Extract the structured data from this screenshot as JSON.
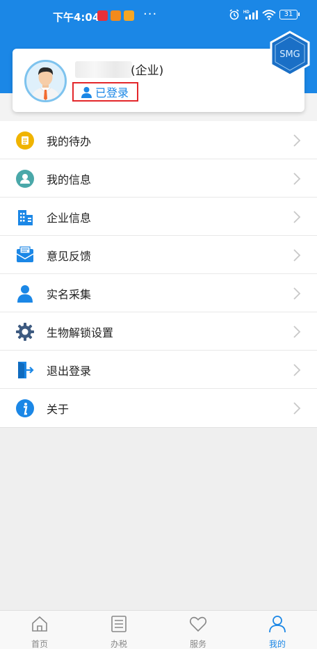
{
  "status_bar": {
    "time": "下午4:04",
    "more": "···",
    "battery": "31"
  },
  "profile": {
    "company_suffix": "(企业)",
    "login_status": "已登录",
    "badge_text": "SMG"
  },
  "menu": {
    "items": [
      {
        "label": "我的待办",
        "icon": "todo-icon"
      },
      {
        "label": "我的信息",
        "icon": "user-info-icon"
      },
      {
        "label": "企业信息",
        "icon": "building-icon"
      },
      {
        "label": "意见反馈",
        "icon": "feedback-icon"
      },
      {
        "label": "实名采集",
        "icon": "person-icon"
      },
      {
        "label": "生物解锁设置",
        "icon": "gear-icon"
      },
      {
        "label": "退出登录",
        "icon": "logout-icon"
      },
      {
        "label": "关于",
        "icon": "info-icon"
      }
    ]
  },
  "tabbar": {
    "tabs": [
      {
        "label": "首页",
        "icon": "home-icon"
      },
      {
        "label": "办税",
        "icon": "list-icon"
      },
      {
        "label": "服务",
        "icon": "heart-icon"
      },
      {
        "label": "我的",
        "icon": "profile-icon"
      }
    ],
    "active": "我的"
  },
  "colors": {
    "brand_blue": "#1b87e6",
    "highlight_red": "#e3262a",
    "todo_yellow": "#f0b400",
    "info_teal": "#4aa8a9"
  }
}
